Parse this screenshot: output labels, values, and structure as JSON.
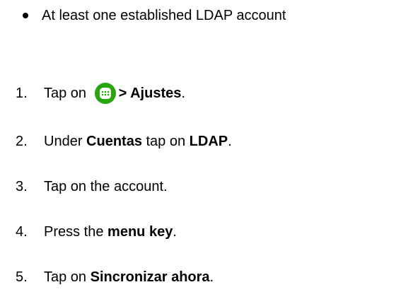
{
  "requirements": [
    "At least one established LDAP account"
  ],
  "steps": [
    {
      "num": "1.",
      "pre": "Tap on ",
      "icon": "apps-launcher-icon",
      "bold": "> Ajustes",
      "post": "."
    },
    {
      "num": "2.",
      "pre": "Under ",
      "bold1": "Cuentas",
      "mid": " tap on ",
      "bold2": "LDAP",
      "post": "."
    },
    {
      "num": "3.",
      "text": "Tap on the account."
    },
    {
      "num": "4.",
      "pre": "Press the ",
      "bold": "menu key",
      "post": "."
    },
    {
      "num": "5.",
      "pre": "Tap on ",
      "bold": "Sincronizar ahora",
      "post": "."
    }
  ],
  "colors": {
    "apps_icon_green": "#2aa512",
    "text": "#000000"
  }
}
